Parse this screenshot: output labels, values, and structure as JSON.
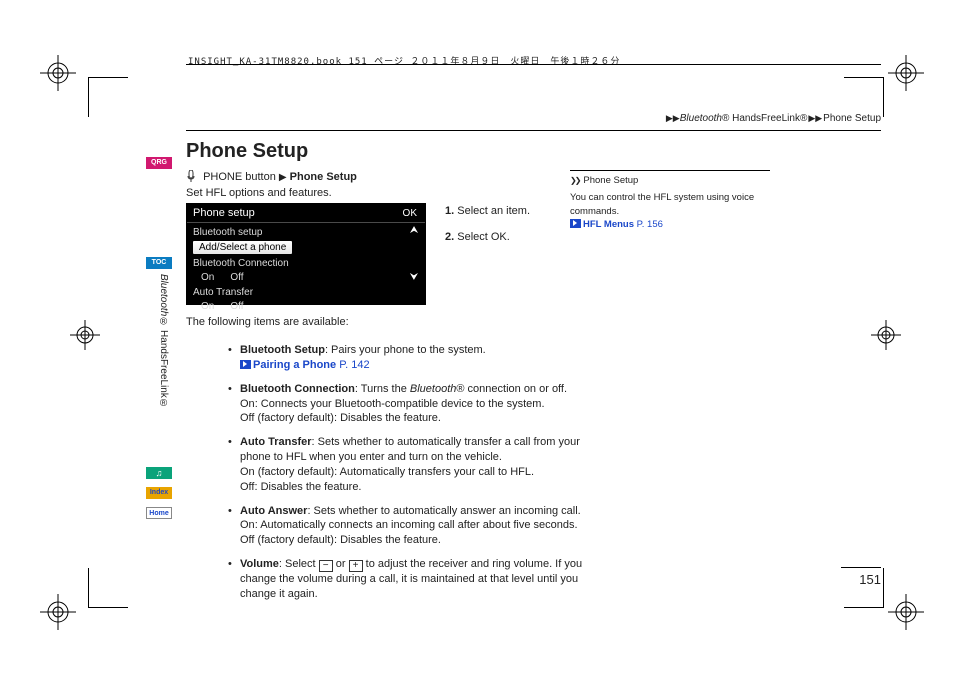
{
  "meta": {
    "line": "INSIGHT_KA-31TM8820.book  151 ページ  ２０１１年８月９日　火曜日　午後１時２６分"
  },
  "breadcrumb": {
    "sep": "▶▶",
    "part1_italic": "Bluetooth",
    "part1_rest": "® HandsFreeLink®",
    "part2": "Phone Setup"
  },
  "title": "Phone Setup",
  "button_line": {
    "btn": "PHONE button",
    "arrow": "▶",
    "dest": "Phone Setup"
  },
  "subtitle": "Set HFL options and features.",
  "screenshot": {
    "title": "Phone setup",
    "ok": "OK",
    "r1": "Bluetooth setup",
    "r1_sel": "Add/Select a phone",
    "r2": "Bluetooth Connection",
    "r2_on": "On",
    "r2_off": "Off",
    "r3": "Auto Transfer",
    "r3_on": "On",
    "r3_off": "Off"
  },
  "steps": {
    "s1n": "1.",
    "s1t": " Select an item.",
    "s2n": "2.",
    "s2t": " Select ",
    "s2ok": "OK",
    "s2end": "."
  },
  "available": "The following items are available:",
  "bullets": {
    "b1": {
      "name": "Bluetooth Setup",
      "rest": ": Pairs your phone to the system.",
      "link_text": "Pairing a Phone",
      "link_page": " P. 142"
    },
    "b2": {
      "name": "Bluetooth Connection",
      "rest1": ": Turns the ",
      "rest1_i": "Bluetooth",
      "rest1_r": "® connection on or off.",
      "on_lbl": "On",
      "on_txt": ": Connects your Bluetooth-compatible device to the system.",
      "off_lbl": "Off",
      "off_txt": " (factory default): Disables the feature."
    },
    "b3": {
      "name": "Auto Transfer",
      "rest": ": Sets whether to automatically transfer a call from your phone to HFL when you enter and turn on the vehicle.",
      "on_lbl": "On",
      "on_txt": " (factory default): Automatically transfers your call to HFL.",
      "off_lbl": "Off",
      "off_txt": ": Disables the feature."
    },
    "b4": {
      "name": "Auto Answer",
      "rest": ": Sets whether to automatically answer an incoming call.",
      "on_lbl": "On",
      "on_txt": ": Automatically connects an incoming call after about five seconds.",
      "off_lbl": "Off",
      "off_txt": " (factory default): Disables the feature."
    },
    "b5": {
      "name": "Volume",
      "rest1": ": Select ",
      "minus": "−",
      "rest_or": " or ",
      "plus": "+",
      "rest2": " to adjust the receiver and ring volume. If you change the volume during a call, it is maintained at that level until you change it again."
    }
  },
  "sidebox": {
    "arrs": "❯❯",
    "title": "Phone Setup",
    "body": "You can control the HFL system using voice commands.",
    "link_text": "HFL Menus",
    "link_page": " P. 156"
  },
  "side_text": {
    "italic": "Bluetooth",
    "rest": "® HandsFreeLink®"
  },
  "tabs": {
    "qrg": "QRG",
    "toc": "TOC",
    "voice": "♫",
    "idx": "Index",
    "home": "Home"
  },
  "page": "151"
}
